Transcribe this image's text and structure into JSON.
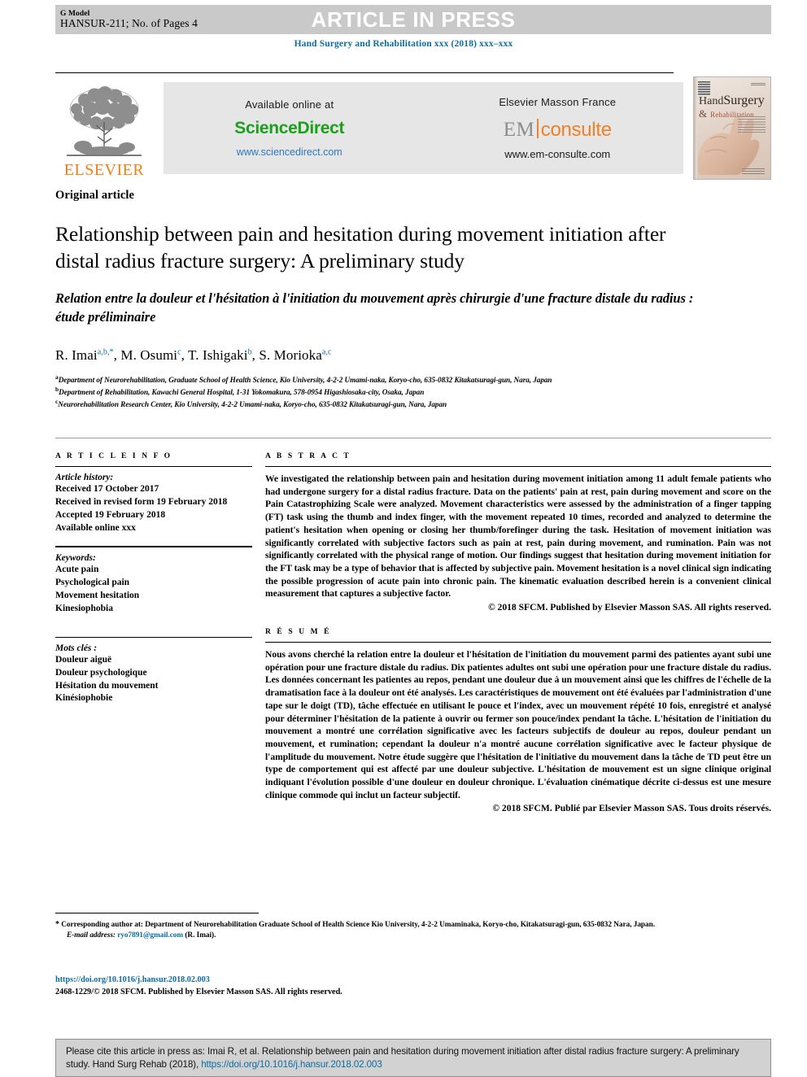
{
  "header": {
    "g_model": "G Model",
    "manuscript_id": "HANSUR-211; No. of Pages 4",
    "article_in_press": "ARTICLE IN PRESS",
    "running_head": "Hand Surgery and Rehabilitation xxx (2018) xxx–xxx"
  },
  "masthead": {
    "elsevier_wordmark": "ELSEVIER",
    "available_online_at": "Available online at",
    "sciencedirect_science": "Science",
    "sciencedirect_direct": "Direct",
    "sciencedirect_url": "www.sciencedirect.com",
    "elsevier_masson_france": "Elsevier Masson France",
    "em_em": "EM",
    "em_consulte": "consulte",
    "emconsulte_url": "www.em-consulte.com",
    "cover": {
      "hand": "Hand",
      "surgery": "Surgery",
      "amp": "&",
      "rehabilitation": "Rehabilitation"
    }
  },
  "article": {
    "kicker": "Original article",
    "title": "Relationship between pain and hesitation during movement initiation after distal radius fracture surgery: A preliminary study",
    "subtitle": "Relation entre la douleur et l'hésitation à l'initiation du mouvement après chirurgie d'une fracture distale du radius : étude préliminaire",
    "authors_plain": "R. Imai a,b,*, M. Osumi c, T. Ishigaki b, S. Morioka a,c",
    "affiliations": [
      {
        "marker": "a",
        "text": "Department of Neurorehabilitation, Graduate School of Health Science, Kio University, 4-2-2 Umami-naka, Koryo-cho, 635-0832 Kitakatsuragi-gun, Nara, Japan"
      },
      {
        "marker": "b",
        "text": "Department of Rehabilitation, Kawachi General Hospital, 1-31 Yokomakura, 578-0954 Higashiosaka-city, Osaka, Japan"
      },
      {
        "marker": "c",
        "text": "Neurorehabilitation Research Center, Kio University, 4-2-2 Umami-naka, Koryo-cho, 635-0832 Kitakatsuragi-gun, Nara, Japan"
      }
    ]
  },
  "article_info": {
    "heading": "A R T I C L E  I N F O",
    "history_label": "Article history:",
    "history": [
      "Received 17 October 2017",
      "Received in revised form 19 February 2018",
      "Accepted 19 February 2018",
      "Available online xxx"
    ],
    "keywords_label": "Keywords:",
    "keywords": [
      "Acute pain",
      "Psychological pain",
      "Movement hesitation",
      "Kinesiophobia"
    ],
    "motscles_label": "Mots clés :",
    "motscles": [
      "Douleur aiguë",
      "Douleur psychologique",
      "Hésitation du mouvement",
      "Kinésiophobie"
    ]
  },
  "abstract": {
    "heading": "A B S T R A C T",
    "body": "We investigated the relationship between pain and hesitation during movement initiation among 11 adult female patients who had undergone surgery for a distal radius fracture. Data on the patients' pain at rest, pain during movement and score on the Pain Catastrophizing Scale were analyzed. Movement characteristics were assessed by the administration of a finger tapping (FT) task using the thumb and index finger, with the movement repeated 10 times, recorded and analyzed to determine the patient's hesitation when opening or closing her thumb/forefinger during the task. Hesitation of movement initiation was significantly correlated with subjective factors such as pain at rest, pain during movement, and rumination. Pain was not significantly correlated with the physical range of motion. Our findings suggest that hesitation during movement initiation for the FT task may be a type of behavior that is affected by subjective pain. Movement hesitation is a novel clinical sign indicating the possible progression of acute pain into chronic pain. The kinematic evaluation described herein is a convenient clinical measurement that captures a subjective factor.",
    "copyright": "© 2018 SFCM. Published by Elsevier Masson SAS. All rights reserved."
  },
  "resume": {
    "heading": "R É S U M É",
    "body": "Nous avons cherché la relation entre la douleur et l'hésitation de l'initiation du mouvement parmi des patientes ayant subi une opération pour une fracture distale du radius. Dix patientes adultes ont subi une opération pour une fracture distale du radius. Les données concernant les patientes au repos, pendant une douleur due à un mouvement ainsi que les chiffres de l'échelle de la dramatisation face à la douleur ont été analysés. Les caractéristiques de mouvement ont été évaluées par l'administration d'une tape sur le doigt (TD), tâche effectuée en utilisant le pouce et l'index, avec un mouvement répété 10 fois, enregistré et analysé pour déterminer l'hésitation de la patiente à ouvrir ou fermer son pouce/index pendant la tâche. L'hésitation de l'initiation du mouvement a montré une corrélation significative avec les facteurs subjectifs de douleur au repos, douleur pendant un mouvement, et rumination; cependant la douleur n'a montré aucune corrélation significative avec le facteur physique de l'amplitude du mouvement. Notre étude suggère que l'hésitation de l'initiative du mouvement dans la tâche de TD peut être un type de comportement qui est affecté par une douleur subjective. L'hésitation de mouvement est un signe clinique original indiquant l'évolution possible d'une douleur en douleur chronique. L'évaluation cinématique décrite ci-dessus est une mesure clinique commode qui inclut un facteur subjectif.",
    "copyright": "© 2018 SFCM. Publié par Elsevier Masson SAS. Tous droits réservés."
  },
  "footnotes": {
    "corresponding_marker": "*",
    "corresponding": "Corresponding author at: Department of Neurorehabilitation Graduate School of Health Science Kio University, 4-2-2 Umaminaka, Koryo-cho, Kitakatsuragi-gun, 635-0832 Nara, Japan.",
    "email_label": "E-mail address:",
    "email": "ryo7891@gmail.com",
    "email_owner": "(R. Imai).",
    "doi": "https://doi.org/10.1016/j.hansur.2018.02.003",
    "issn_line": "2468-1229/© 2018 SFCM. Published by Elsevier Masson SAS. All rights reserved."
  },
  "cite_box": {
    "text_before": "Please cite this article in press as: Imai R, et al. Relationship between pain and hesitation during movement initiation after distal radius fracture surgery: A preliminary study. Hand Surg Rehab (2018),",
    "link": "https://doi.org/10.1016/j.hansur.2018.02.003"
  },
  "colors": {
    "journal_blue": "#0b6ca0",
    "elsevier_orange": "#f07e13",
    "sciencedirect_green": "#1aa01a",
    "link_blue": "#2b78c0"
  }
}
